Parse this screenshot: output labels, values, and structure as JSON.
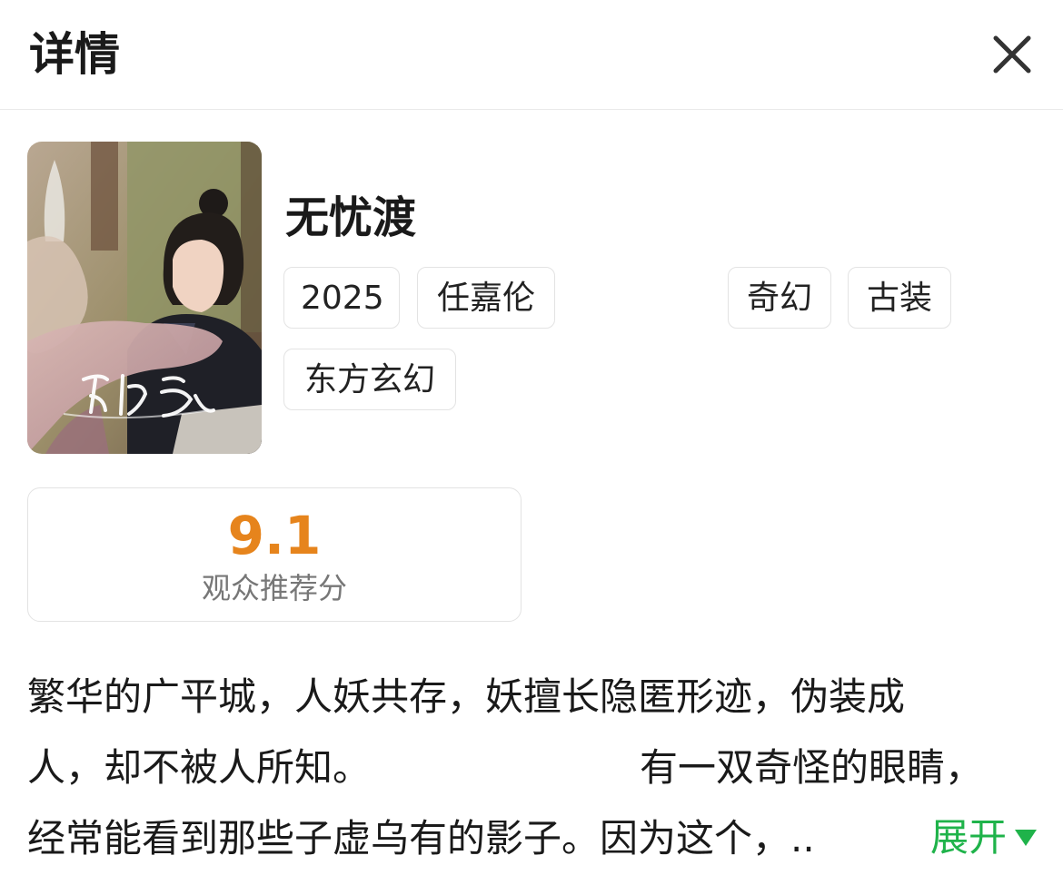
{
  "header": {
    "title": "详情",
    "close_icon": "close-icon"
  },
  "show": {
    "poster_logo_text": "无忧渡",
    "title": "无忧渡",
    "tags": [
      "2025",
      "任嘉伦",
      "奇幻",
      "古装",
      "东方玄幻"
    ]
  },
  "score": {
    "value": "9.1",
    "label": "观众推荐分",
    "color": "#e6841c"
  },
  "synopsis": {
    "lines": [
      "繁华的广平城，人妖共存，妖擅长隐匿形迹，伪装成",
      "人，却不被人所知。",
      "有一双奇怪的眼睛，",
      "经常能看到那些子虚乌有的影子。因为这个，.."
    ],
    "expand_label": "展开",
    "expand_icon": "triangle-down-icon",
    "accent_color": "#1fb34a"
  }
}
